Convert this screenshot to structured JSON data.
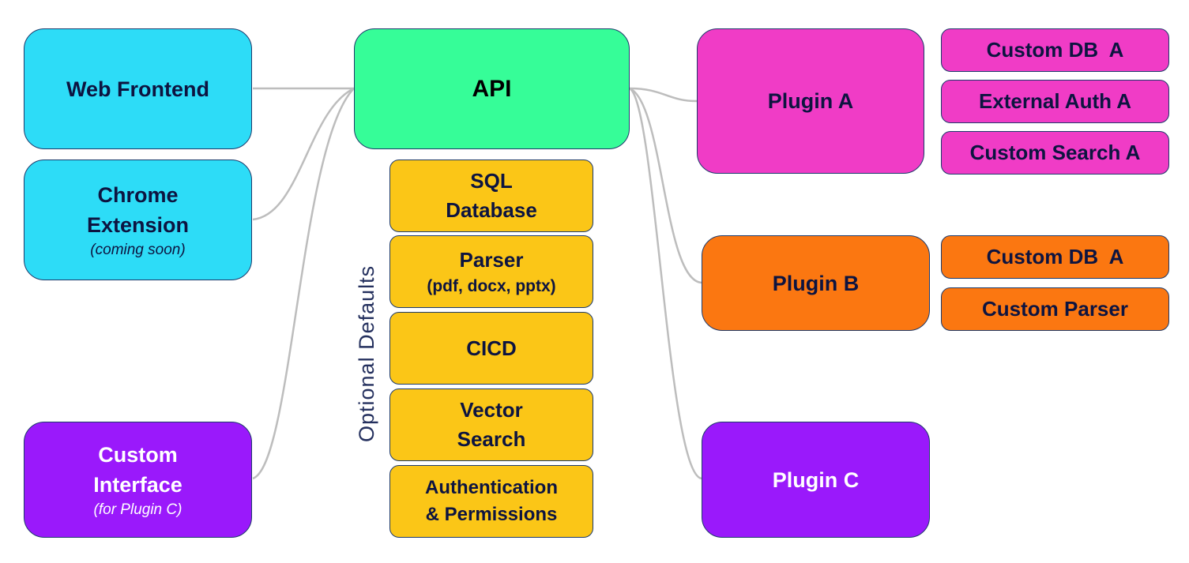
{
  "diagram": {
    "clients": [
      {
        "label": "Web Frontend",
        "sub": null,
        "color": "#2ddcf7"
      },
      {
        "label_line1": "Chrome",
        "label_line2": "Extension",
        "sub": "(coming soon)",
        "color": "#2ddcf7"
      },
      {
        "label_line1": "Custom",
        "label_line2": "Interface",
        "sub": "(for Plugin C)",
        "color": "#9a19fb"
      }
    ],
    "api": {
      "label": "API",
      "color": "#36fd98"
    },
    "optional_defaults": {
      "label": "Optional Defaults",
      "color": "#fbc617",
      "items": [
        {
          "line1": "SQL",
          "line2": "Database"
        },
        {
          "line1": "Parser",
          "line2": "(pdf, docx, pptx)"
        },
        {
          "line1": "CICD",
          "line2": ""
        },
        {
          "line1": "Vector",
          "line2": "Search"
        },
        {
          "line1": "Authentication",
          "line2": "& Permissions"
        }
      ]
    },
    "plugins": [
      {
        "label": "Plugin A",
        "color": "#f03cc6",
        "components": [
          "Custom DB  A",
          "External Auth A",
          "Custom Search A"
        ]
      },
      {
        "label": "Plugin B",
        "color": "#fb7711",
        "components": [
          "Custom DB  A",
          "Custom Parser"
        ]
      },
      {
        "label": "Plugin C",
        "color": "#9a19fb",
        "components": []
      }
    ],
    "connector_color": "#bdbdbd",
    "connections": [
      [
        "Web Frontend",
        "API"
      ],
      [
        "Chrome Extension",
        "API"
      ],
      [
        "Custom Interface",
        "API"
      ],
      [
        "API",
        "Plugin A"
      ],
      [
        "API",
        "Plugin B"
      ],
      [
        "API",
        "Plugin C"
      ]
    ]
  }
}
